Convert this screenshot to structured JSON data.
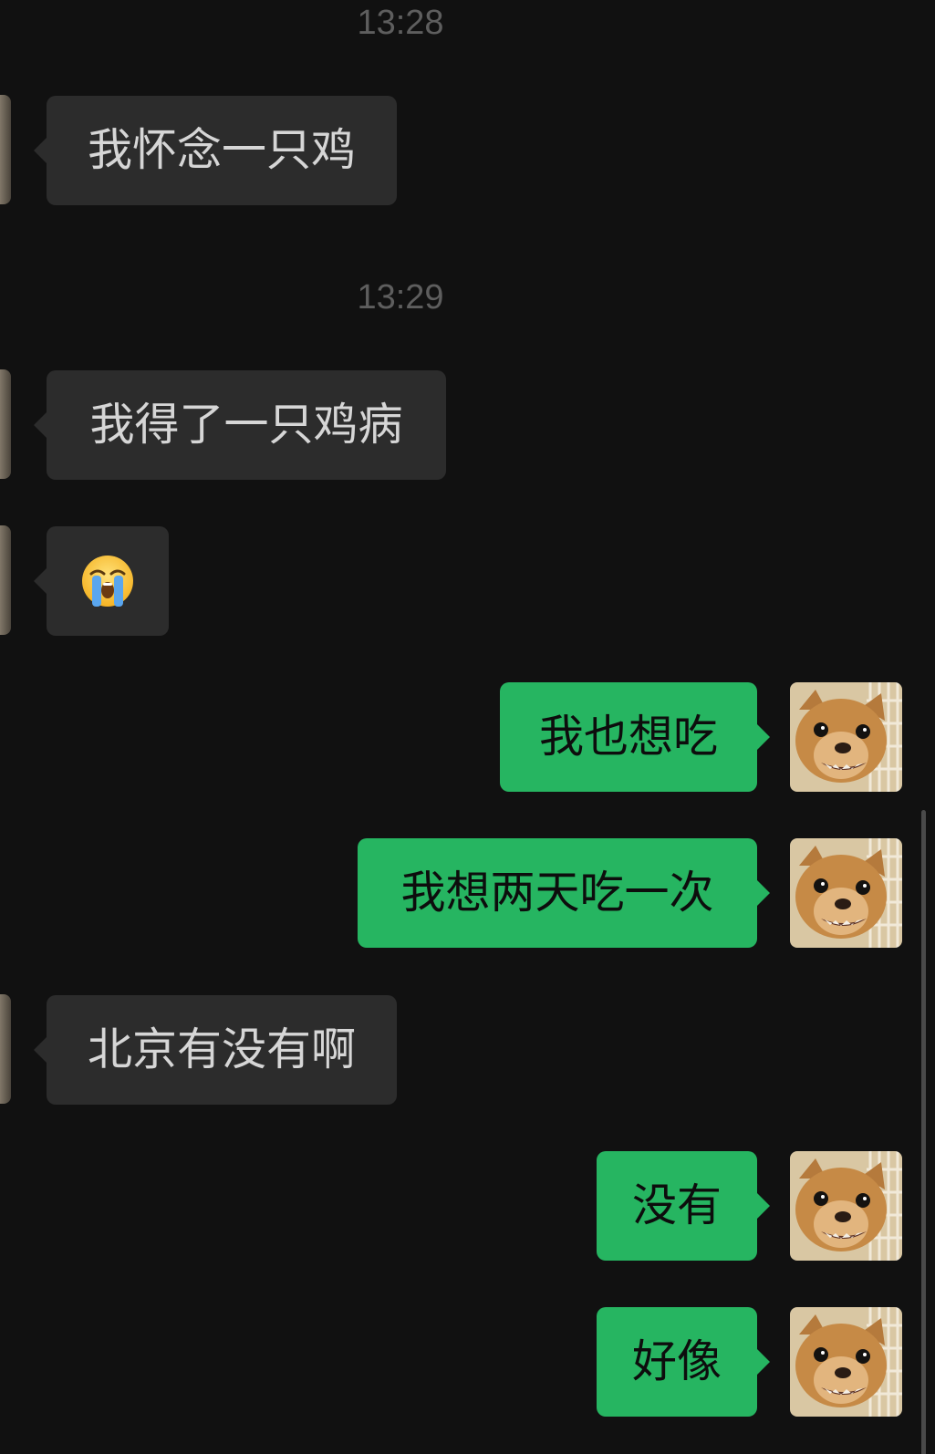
{
  "chat": {
    "time_1": "13:28",
    "time_2": "13:29",
    "messages": [
      {
        "text": "我怀念一只鸡"
      },
      {
        "text": "我得了一只鸡病"
      },
      {
        "emoji_icon": "loudly-crying-face-icon"
      },
      {
        "text": "我也想吃"
      },
      {
        "text": "我想两天吃一次"
      },
      {
        "text": "北京有没有啊"
      },
      {
        "text": "没有"
      },
      {
        "text": "好像"
      }
    ]
  },
  "icons": {
    "self_avatar": "chihuahua-avatar-icon",
    "contact_avatar": "contact-avatar-icon"
  },
  "colors": {
    "background": "#111111",
    "incoming_bubble": "#2c2c2c",
    "incoming_text": "#d6d6d6",
    "outgoing_bubble": "#26b561",
    "outgoing_text": "#0d0d0d",
    "timestamp": "#5e5e5e"
  }
}
